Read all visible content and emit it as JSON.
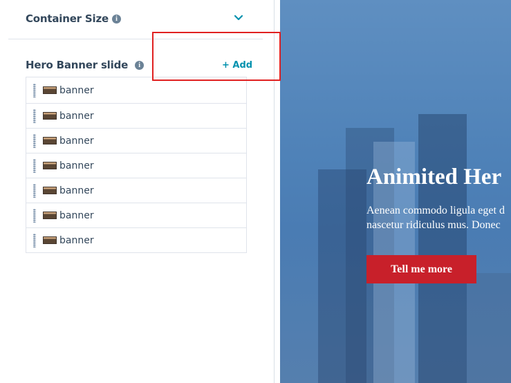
{
  "container_size": {
    "label": "Container Size",
    "info": "i"
  },
  "hero_banner": {
    "label": "Hero Banner slide",
    "info": "i",
    "add_label": "+ Add",
    "items": [
      {
        "label": "banner"
      },
      {
        "label": "banner"
      },
      {
        "label": "banner"
      },
      {
        "label": "banner"
      },
      {
        "label": "banner"
      },
      {
        "label": "banner"
      },
      {
        "label": "banner"
      }
    ]
  },
  "preview": {
    "title": "Animited Her",
    "text_line1": "Aenean commodo ligula eget d",
    "text_line2": "nascetur ridiculus mus. Donec",
    "button_label": "Tell me more"
  },
  "colors": {
    "accent": "#0091ae",
    "highlight": "#e02020",
    "button": "#c8202a"
  }
}
